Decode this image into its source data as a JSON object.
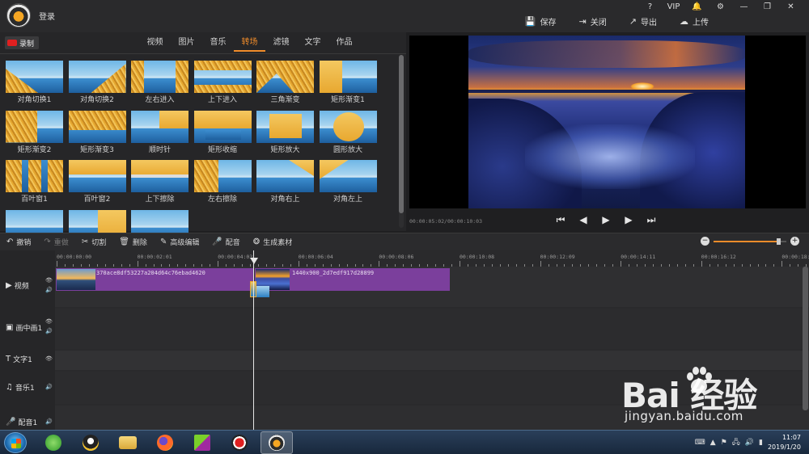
{
  "app": {
    "login_label": "登录",
    "window_icons": [
      "?",
      "VIP",
      "🔔",
      "⚙",
      "—",
      "❐",
      "✕"
    ],
    "actions": [
      {
        "icon": "save-icon",
        "label": "保存"
      },
      {
        "icon": "close-icon",
        "label": "关闭"
      },
      {
        "icon": "export-icon",
        "label": "导出"
      },
      {
        "icon": "upload-icon",
        "label": "上传"
      }
    ]
  },
  "media": {
    "record_label": "录制",
    "tabs": [
      {
        "label": "视频",
        "active": false
      },
      {
        "label": "图片",
        "active": false
      },
      {
        "label": "音乐",
        "active": false
      },
      {
        "label": "转场",
        "active": true
      },
      {
        "label": "滤镜",
        "active": false
      },
      {
        "label": "文字",
        "active": false
      },
      {
        "label": "作品",
        "active": false
      }
    ],
    "transitions": [
      "对角切换1",
      "对角切换2",
      "左右进入",
      "上下进入",
      "三角渐变",
      "矩形渐变1",
      "矩形渐变2",
      "矩形渐变3",
      "顺时针",
      "矩形收缩",
      "矩形放大",
      "圆形放大",
      "百叶窗1",
      "百叶窗2",
      "上下擦除",
      "左右擦除",
      "对角右上",
      "对角左上",
      "",
      "",
      ""
    ]
  },
  "preview": {
    "timecode": "00:00:05:02/00:00:10:03",
    "controls": [
      "skip-start-icon",
      "prev-frame-icon",
      "play-icon",
      "next-frame-icon",
      "skip-end-icon"
    ]
  },
  "toolbar": {
    "tools": [
      {
        "icon": "undo-icon",
        "glyph": "↶",
        "label": "撤销",
        "enabled": true
      },
      {
        "icon": "redo-icon",
        "glyph": "↷",
        "label": "重做",
        "enabled": false
      },
      {
        "icon": "cut-icon",
        "glyph": "✂",
        "label": "切割",
        "enabled": true
      },
      {
        "icon": "delete-icon",
        "glyph": "🗑",
        "label": "删除",
        "enabled": true
      },
      {
        "icon": "edit-icon",
        "glyph": "✎",
        "label": "高级编辑",
        "enabled": true
      },
      {
        "icon": "mic-icon",
        "glyph": "🎤",
        "label": "配音",
        "enabled": true
      },
      {
        "icon": "generate-icon",
        "glyph": "❂",
        "label": "生成素材",
        "enabled": true
      }
    ],
    "zoom_level": 0.9
  },
  "timeline": {
    "ticks": [
      "00:00:00:00",
      "00:00:02:01",
      "00:00:04:03",
      "00:00:06:04",
      "00:00:08:06",
      "00:00:10:08",
      "00:00:12:09",
      "00:00:14:11",
      "00:00:16:12",
      "00:00:18:14"
    ],
    "tracks": [
      {
        "icon": "video-track-icon",
        "glyph": "▶",
        "label": "视频"
      },
      {
        "icon": "pip-track-icon",
        "glyph": "▣",
        "label": "画中画1"
      },
      {
        "icon": "text-track-icon",
        "glyph": "T",
        "label": "文字1"
      },
      {
        "icon": "music-track-icon",
        "glyph": "♫",
        "label": "音乐1"
      },
      {
        "icon": "dub-track-icon",
        "glyph": "🎤",
        "label": "配音1"
      }
    ],
    "clips": [
      {
        "name": "370ace8df53227a204d64c76ebad4620"
      },
      {
        "name": "1440x900_2d7edf917d28899"
      }
    ]
  },
  "taskbar": {
    "time": "11:07",
    "date": "2019/1/20"
  },
  "watermark": {
    "brand": "Bai  经验",
    "url": "jingyan.baidu.com"
  },
  "colors": {
    "accent": "#f08c2a",
    "clip": "#7b3f9c",
    "background": "#1f1f21"
  }
}
